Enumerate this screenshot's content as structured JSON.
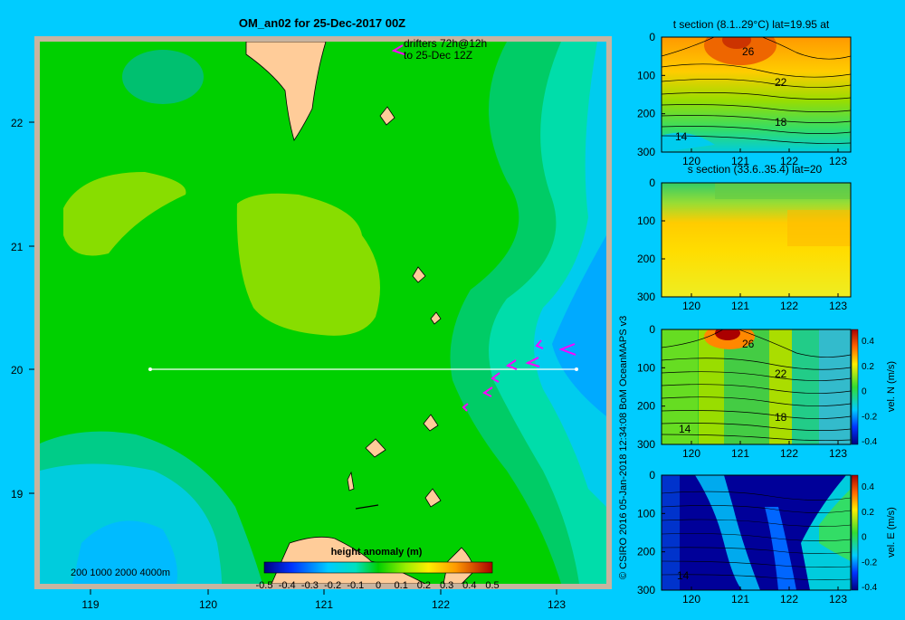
{
  "map": {
    "title": "OM_an02 for 25-Dec-2017 00Z",
    "drifters_line1": "drifters 72h@12h",
    "drifters_line2": "to 25-Dec 12Z",
    "lat_ticks": [
      "22",
      "21",
      "20",
      "19"
    ],
    "lon_ticks": [
      "119",
      "120",
      "121",
      "122",
      "123"
    ],
    "depth_legend": "200  1000  2000  4000m",
    "colorbar_title": "height anomaly (m)",
    "colorbar_ticks": [
      "-0.5",
      "-0.4",
      "-0.3",
      "-0.2",
      "-0.1",
      "0",
      "0.1",
      "0.2",
      "0.3",
      "0.4",
      "0.5"
    ]
  },
  "copyright": "© CSIRO 2016   05-Jan-2018 12:34:08 BoM OceanMAPS v3",
  "panels": {
    "t_title": "t section (8.1..29°C) lat=19.95 at",
    "s_title": "s section (33.6..35.4) lat=20",
    "depth_ticks": [
      "0",
      "100",
      "200",
      "300"
    ],
    "lon_ticks": [
      "120",
      "121",
      "122",
      "123"
    ],
    "contour_labels": {
      "t": [
        "26",
        "22",
        "18",
        "14"
      ],
      "n": [
        "26",
        "22",
        "18",
        "14"
      ],
      "e": [
        "14"
      ]
    },
    "velN_label": "vel. N (m/s)",
    "velE_label": "vel. E (m/s)",
    "vel_ticks": [
      "0.4",
      "0.2",
      "0",
      "-0.2",
      "-0.4"
    ]
  },
  "colors": {
    "background": "#00ccff",
    "land": "#ffcc99",
    "shelf": "#c8b4a0",
    "drifter": "#ff00ff"
  }
}
